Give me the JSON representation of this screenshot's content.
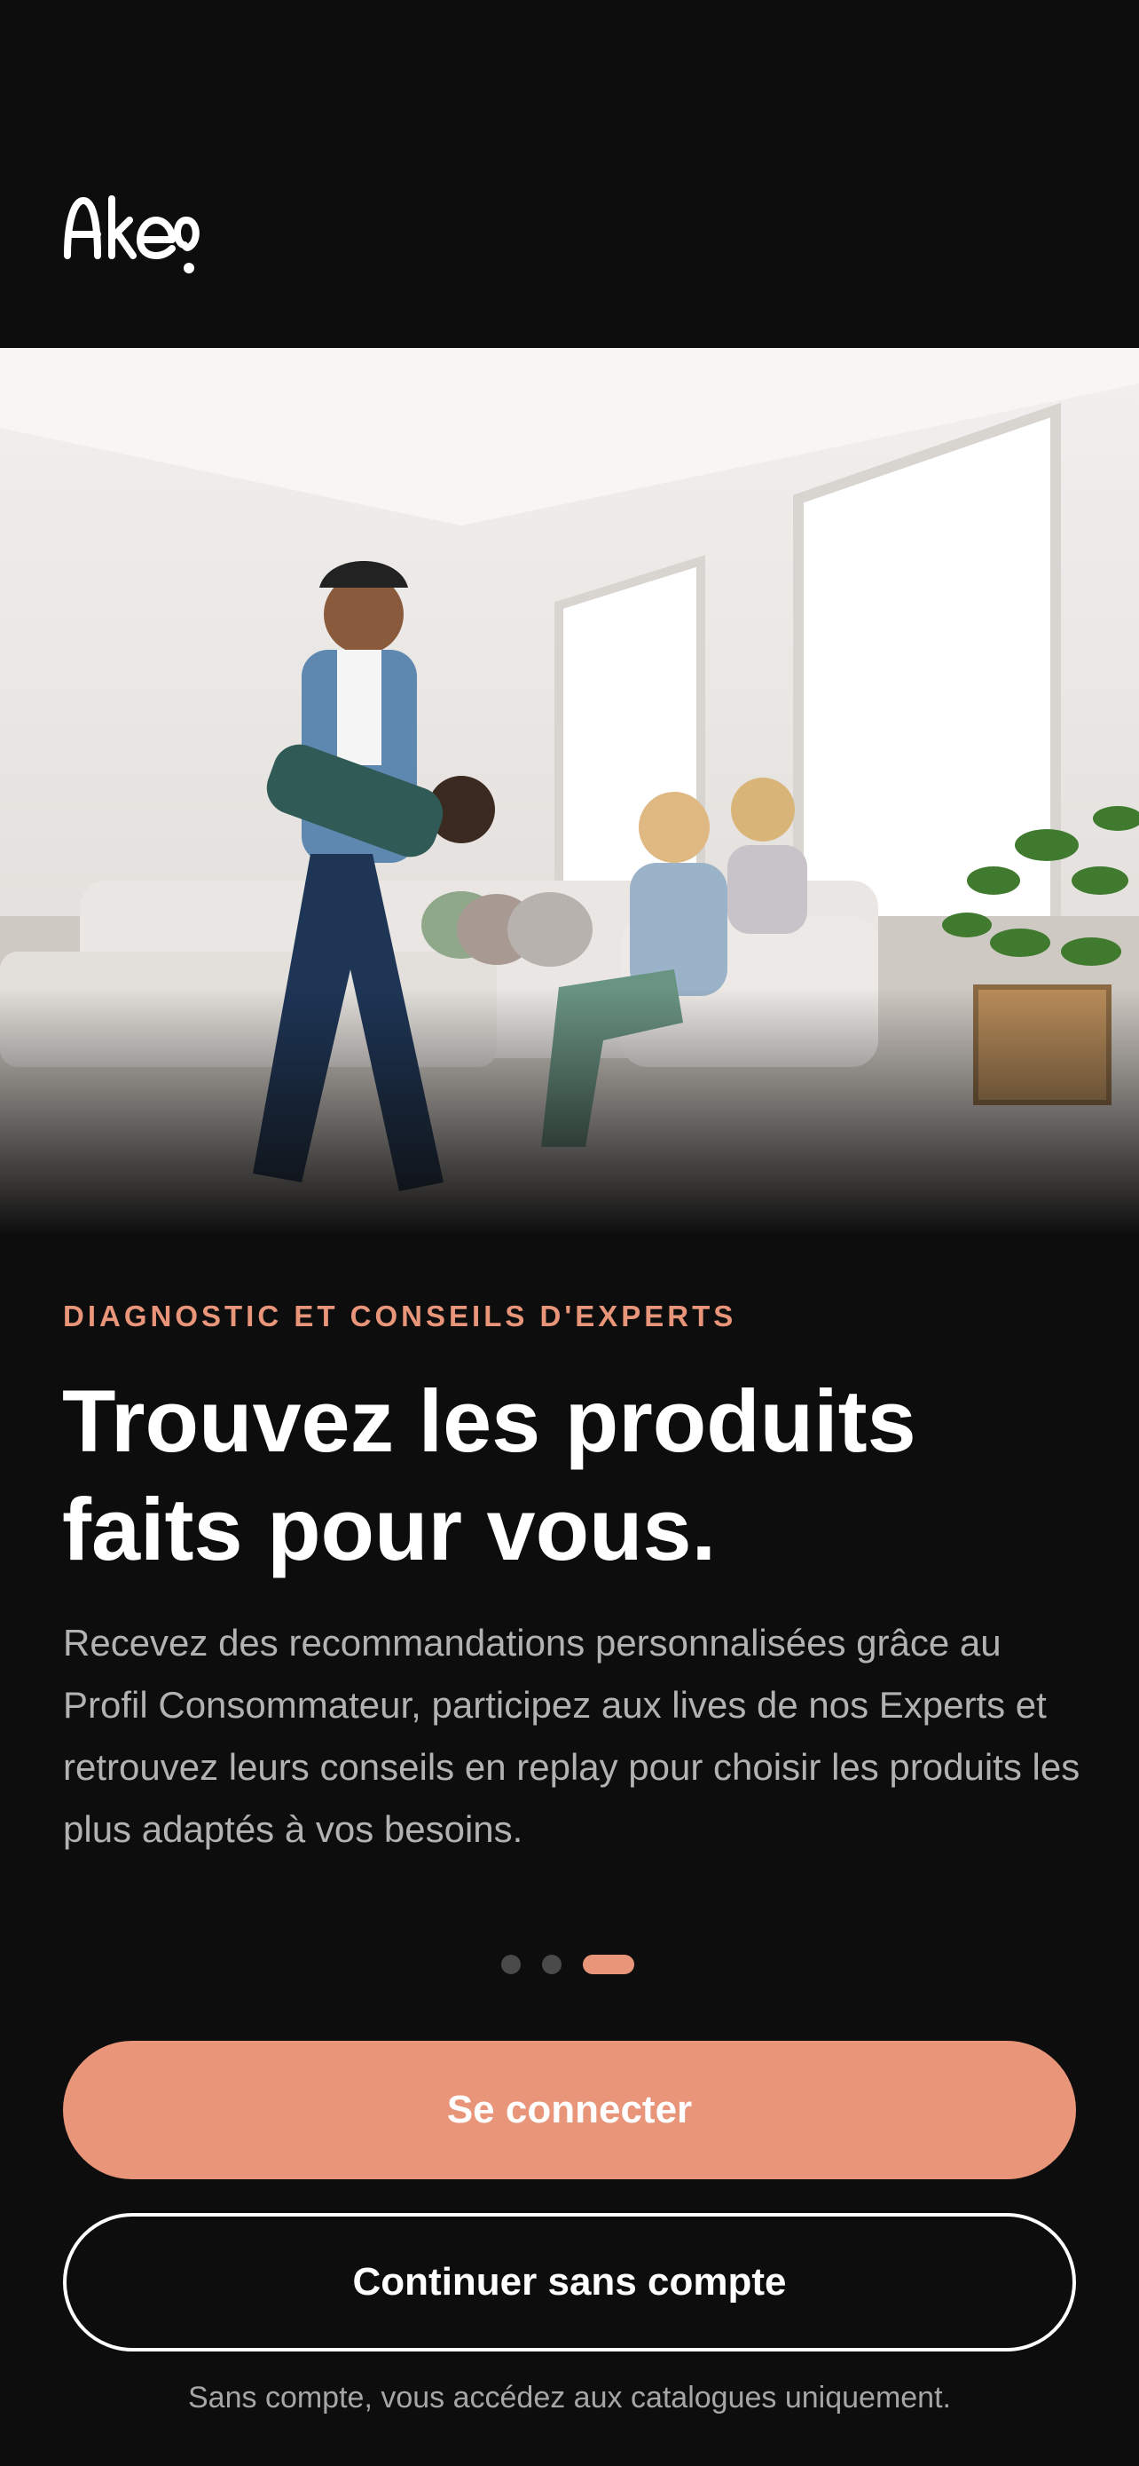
{
  "brand": {
    "name": "Akeo",
    "accent_color": "#e8957a",
    "background": "#0d0d0d"
  },
  "hero": {
    "image": "family-living-room-photo"
  },
  "onboarding": {
    "eyebrow": "DIAGNOSTIC ET CONSEILS D'EXPERTS",
    "headline_line1": "Trouvez les produits",
    "headline_line2": "faits pour vous.",
    "body": "Recevez des recommandations personnalisées grâce au Profil Consommateur, participez aux lives de nos Experts et retrouvez leurs conseils en replay pour choisir les produits les plus adaptés à vos besoins.",
    "pagination": {
      "total": 3,
      "current": 3
    }
  },
  "actions": {
    "primary_label": "Se connecter",
    "secondary_label": "Continuer sans compte",
    "footnote": "Sans compte, vous accédez aux catalogues uniquement."
  }
}
